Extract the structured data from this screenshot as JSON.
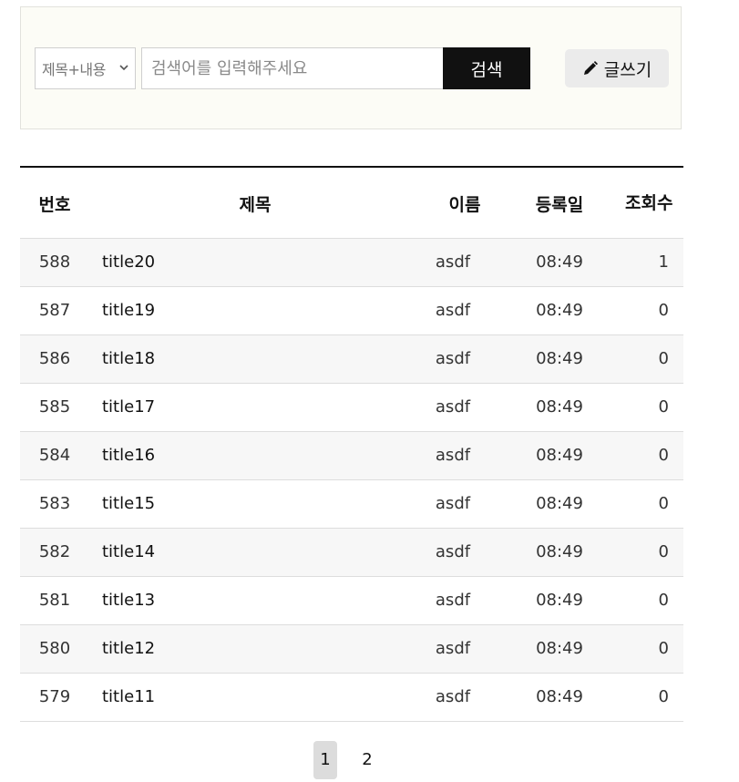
{
  "search": {
    "field_selected": "제목+내용",
    "placeholder": "검색어를 입력해주세요",
    "value": "",
    "button_label": "검색"
  },
  "write_button_label": "글쓰기",
  "table": {
    "headers": {
      "no": "번호",
      "title": "제목",
      "name": "이름",
      "date": "등록일",
      "views": "조회수"
    },
    "rows": [
      {
        "no": "588",
        "title": "title20",
        "name": "asdf",
        "date": "08:49",
        "views": "1"
      },
      {
        "no": "587",
        "title": "title19",
        "name": "asdf",
        "date": "08:49",
        "views": "0"
      },
      {
        "no": "586",
        "title": "title18",
        "name": "asdf",
        "date": "08:49",
        "views": "0"
      },
      {
        "no": "585",
        "title": "title17",
        "name": "asdf",
        "date": "08:49",
        "views": "0"
      },
      {
        "no": "584",
        "title": "title16",
        "name": "asdf",
        "date": "08:49",
        "views": "0"
      },
      {
        "no": "583",
        "title": "title15",
        "name": "asdf",
        "date": "08:49",
        "views": "0"
      },
      {
        "no": "582",
        "title": "title14",
        "name": "asdf",
        "date": "08:49",
        "views": "0"
      },
      {
        "no": "581",
        "title": "title13",
        "name": "asdf",
        "date": "08:49",
        "views": "0"
      },
      {
        "no": "580",
        "title": "title12",
        "name": "asdf",
        "date": "08:49",
        "views": "0"
      },
      {
        "no": "579",
        "title": "title11",
        "name": "asdf",
        "date": "08:49",
        "views": "0"
      }
    ]
  },
  "pagination": {
    "pages": [
      "1",
      "2"
    ],
    "current": "1"
  },
  "icons": {
    "write": "pencil-icon",
    "select": "chevron-down-icon"
  },
  "colors": {
    "search_button": "#111111",
    "search_bg": "#fcfcf6",
    "active_page": "#dcdcdc"
  }
}
